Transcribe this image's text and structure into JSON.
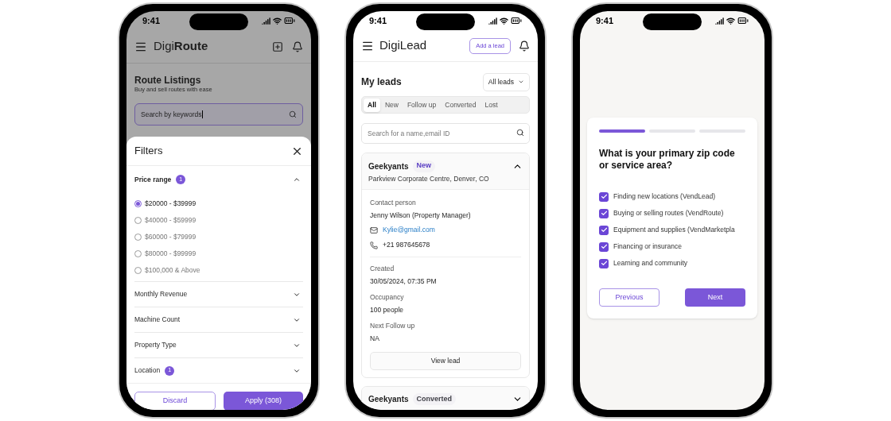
{
  "route_app": {
    "status_time": "9:41",
    "brand": "Digi**Route**",
    "title": "Route Listings",
    "subtitle": "Buy and sell routes with ease",
    "search": {
      "value": "Search by keywords"
    },
    "filters": {
      "title": "Filters",
      "sections": [
        {
          "label": "Price range",
          "badge": "1",
          "expanded": true,
          "options": [
            {
              "label": "$20000 - $39999",
              "selected": true
            },
            {
              "label": "$40000 - $59999",
              "selected": false
            },
            {
              "label": "$60000 - $79999",
              "selected": false
            },
            {
              "label": "$80000 - $99999",
              "selected": false
            },
            {
              "label": "$100,000 & Above",
              "selected": false
            }
          ]
        },
        {
          "label": "Monthly Revenue",
          "expanded": false
        },
        {
          "label": "Machine Count",
          "expanded": false
        },
        {
          "label": "Property Type",
          "expanded": false
        },
        {
          "label": "Location",
          "badge": "1",
          "expanded": false
        }
      ],
      "buttons": [
        {
          "label": "Discard",
          "kind": "secondary"
        },
        {
          "label": "Apply (308)",
          "kind": "primary"
        }
      ]
    }
  },
  "lead_app": {
    "status_time": "9:41",
    "brand": "DigiLead",
    "add_button": "Add a lead",
    "heading": "My leads",
    "dropdown": "All leads",
    "tabs": [
      {
        "label": "All",
        "selected": true
      },
      {
        "label": "New",
        "selected": false
      },
      {
        "label": "Follow up",
        "selected": false
      },
      {
        "label": "Converted",
        "selected": false
      },
      {
        "label": "Lost",
        "selected": false
      }
    ],
    "search": {
      "placeholder": "Search for a name,email ID"
    },
    "leads": [
      {
        "name": "Geekyants",
        "status": "New",
        "color": "#5b3fc4",
        "expanded": true,
        "address": "Parkview Corporate Centre, Denver, CO",
        "contact_label": "Contact person",
        "contact": "Jenny Wilson (Property Manager)",
        "email": "Kylie@gmail.com",
        "phone": "+21 987645678",
        "details": [
          {
            "label": "Created",
            "value": "30/05/2024, 07:35 PM"
          },
          {
            "label": "Occupancy",
            "value": "100 people"
          },
          {
            "label": "Next Follow up",
            "value": "NA"
          }
        ],
        "action": "View lead"
      },
      {
        "name": "Geekyants",
        "status": "Converted",
        "color": "#3f3f46",
        "expanded": false
      }
    ]
  },
  "onboarding": {
    "status_time": "9:41",
    "steps": [
      {
        "done": true
      },
      {
        "done": false
      },
      {
        "done": false
      }
    ],
    "question": "What is your primary zip code or service area?",
    "options": [
      {
        "label": "Finding new locations (VendLead)",
        "checked": true
      },
      {
        "label": "Buying or selling routes (VendRoute)",
        "checked": true
      },
      {
        "label": "Equipment and supplies (VendMarketpla",
        "checked": true
      },
      {
        "label": "Financing or insurance",
        "checked": true
      },
      {
        "label": "Learning and community",
        "checked": true
      }
    ],
    "buttons": [
      {
        "label": "Previous",
        "kind": "secondary"
      },
      {
        "label": "Next",
        "kind": "primary"
      }
    ]
  }
}
